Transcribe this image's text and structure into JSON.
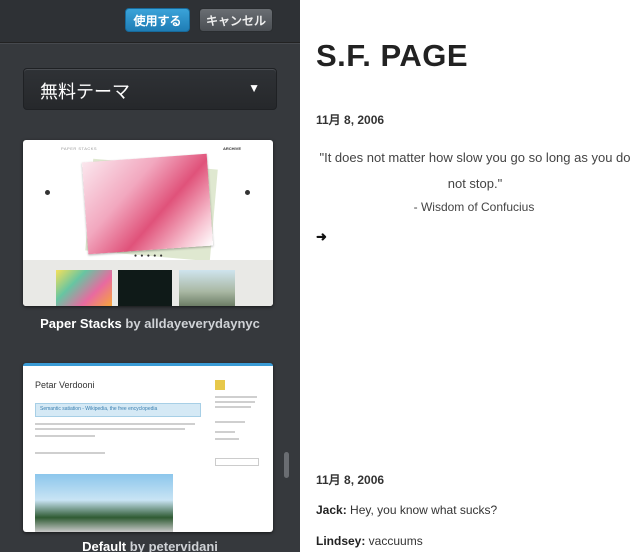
{
  "toolbar": {
    "use_label": "使用する",
    "cancel_label": "キャンセル"
  },
  "filter": {
    "selected": "無料テーマ",
    "arrow": "▼"
  },
  "themes": [
    {
      "name": "Paper Stacks",
      "author_prefix": "by",
      "author": "alldayeverydaynyc",
      "preview_title": "PAPER STACKS",
      "preview_right": "ARCHIVE",
      "preview_dots": "● ● ● ● ●"
    },
    {
      "name": "Default",
      "author_prefix": "by",
      "author": "petervidani",
      "preview_title": "Petar Verdooni",
      "preview_link": "Semantic satiation - Wikipedia, the free encyclopedia"
    }
  ],
  "page": {
    "title": "S.F. PAGE",
    "posts": [
      {
        "date": "11月 8, 2006",
        "quote": "\"It does not matter how slow you go so long as you do not stop.\"",
        "attribution": "- Wisdom of Confucius",
        "arrow": "➜"
      },
      {
        "date": "11月 8, 2006",
        "lines": [
          {
            "speaker": "Jack:",
            "text": " Hey, you know what sucks?"
          },
          {
            "speaker": "Lindsey:",
            "text": " vaccuums"
          }
        ]
      }
    ]
  },
  "colors": {
    "panel_bg": "#36393d",
    "use_button": "#2a8fc7",
    "accent_blue": "#3a9bd5"
  }
}
